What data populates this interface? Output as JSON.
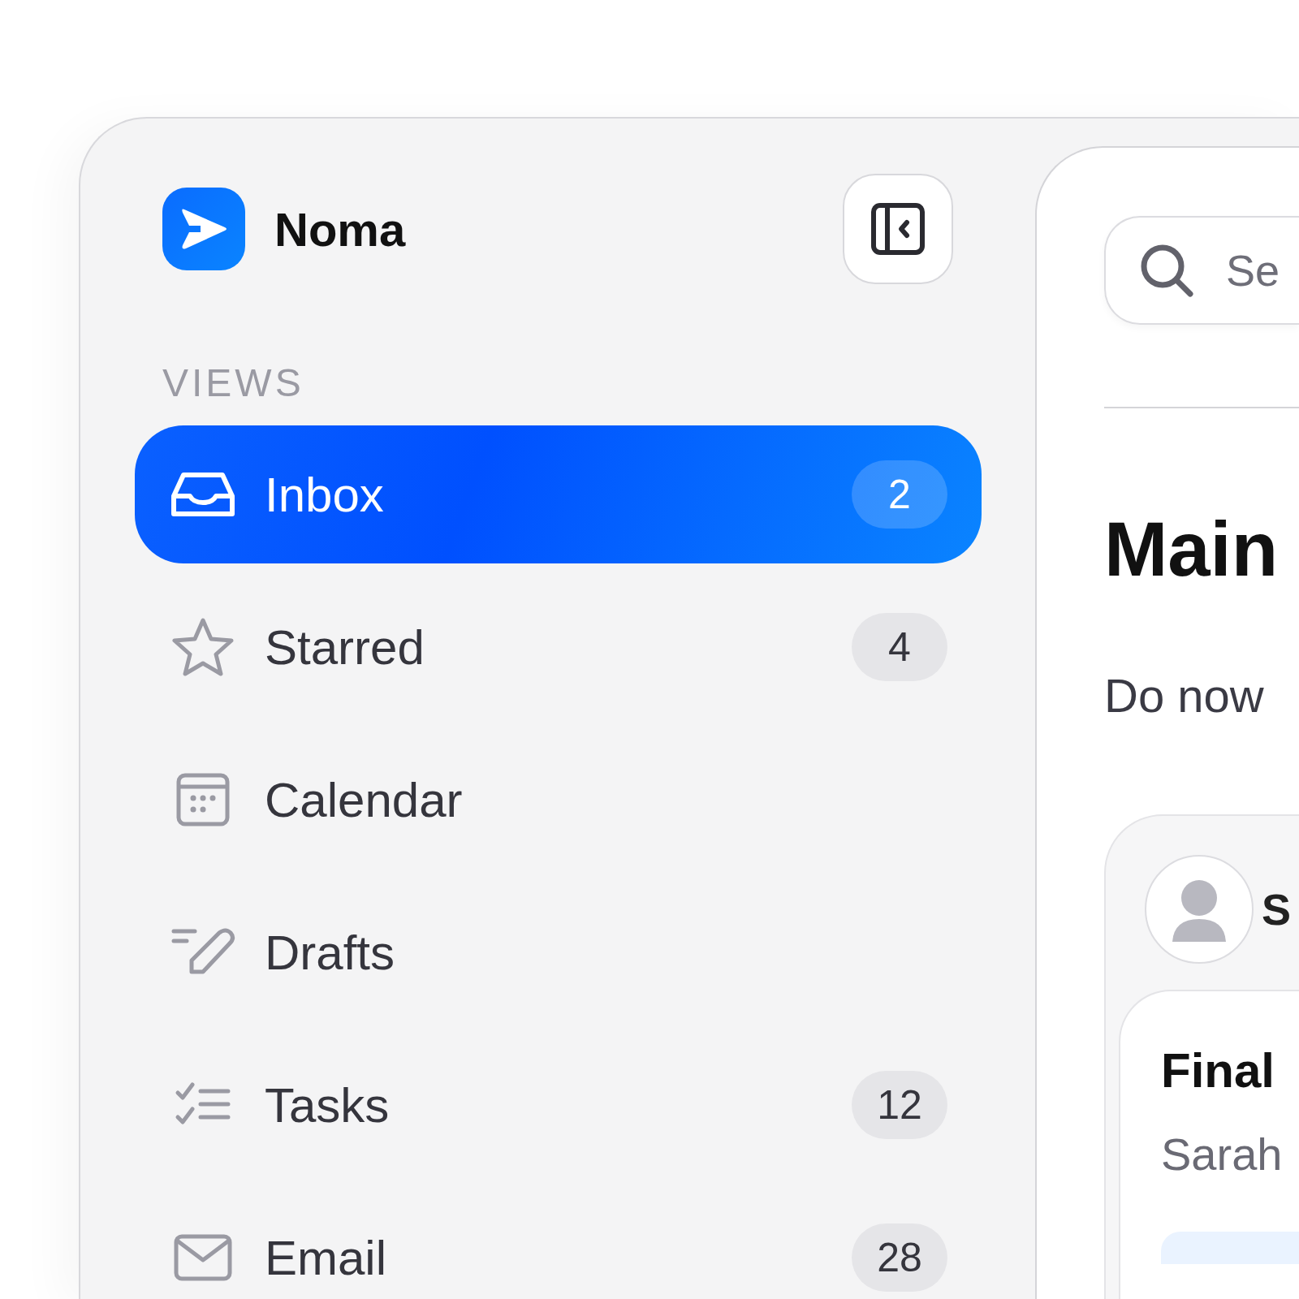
{
  "app": {
    "name": "Noma"
  },
  "sidebar": {
    "section_title": "VIEWS",
    "items": [
      {
        "kind": "inbox",
        "label": "Inbox",
        "count": "2",
        "selected": true
      },
      {
        "kind": "star",
        "label": "Starred",
        "count": "4",
        "selected": false
      },
      {
        "kind": "calendar",
        "label": "Calendar",
        "selected": false
      },
      {
        "kind": "drafts",
        "label": "Drafts",
        "selected": false
      },
      {
        "kind": "tasks",
        "label": "Tasks",
        "count": "12",
        "selected": false
      },
      {
        "kind": "email",
        "label": "Email",
        "count": "28",
        "selected": false
      }
    ]
  },
  "main": {
    "search": {
      "placeholder": "Se"
    },
    "title": "Main",
    "section": "Do now",
    "card": {
      "sender": "S",
      "message": {
        "title": "Final",
        "from": "Sarah"
      }
    }
  }
}
